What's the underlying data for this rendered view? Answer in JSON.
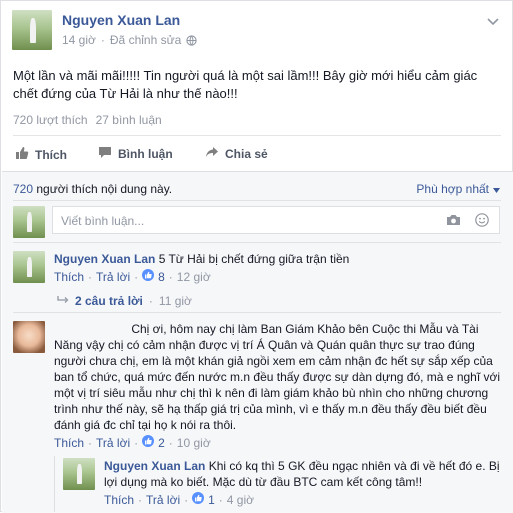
{
  "post": {
    "author": "Nguyen Xuan Lan",
    "time": "14 giờ",
    "separator": "·",
    "edited": "Đã chỉnh sửa",
    "body": "Một lần và mãi mãi!!!!! Tin người quá là một sai lầm!!! Bây giờ mới hiểu cảm giác chết đứng của Từ Hải là như thế nào!!!",
    "likes": "720 lượt thích",
    "comments": "27 bình luận"
  },
  "actions": {
    "like": "Thích",
    "comment": "Bình luận",
    "share": "Chia sẻ"
  },
  "likes_bar": {
    "count": "720",
    "text": "người thích nội dung này.",
    "sort": "Phù hợp nhất"
  },
  "composer": {
    "placeholder": "Viết bình luận..."
  },
  "comments": [
    {
      "author": "Nguyen Xuan Lan",
      "text": "5 Từ Hải bị chết đứng giữa trận tiền",
      "like": "Thích",
      "reply": "Trả lời",
      "reactions": "8",
      "time": "12 giờ",
      "replies_link": "2 câu trả lời",
      "replies_time": "11 giờ"
    },
    {
      "author": "",
      "text": "Chị ơi, hôm nay chị làm Ban Giám Khảo bên Cuộc thi Mẫu và Tài Năng vậy chị có cảm nhận được vị trí Á Quân và Quán quân thực sự trao đúng người chưa chị, em là một khán giả ngồi xem em cảm nhận đc hết sự sắp xếp của ban tổ chức, quá mức đến nước m.n đều thấy được sự dàn dựng đó, mà e nghĩ với một vị trí siêu mẫu như chị thì k nên đi làm giám khảo bù nhìn cho những chương trình như thế này, sẽ hạ thấp giá trị của mình, vì e thấy m.n đều thấy đều biết đều đánh giá đc chỉ tại họ k nói ra thôi.",
      "like": "Thích",
      "reply": "Trả lời",
      "reactions": "2",
      "time": "10 giờ"
    },
    {
      "author": "Nguyen Xuan Lan",
      "text": "Khi có kq thì 5 GK đều ngạc nhiên và đi về hết đó e. Bị lợi dụng mà ko biết. Mặc dù từ đầu BTC cam kết công tâm!!",
      "like": "Thích",
      "reply": "Trả lời",
      "reactions": "1",
      "time": "4 giờ"
    }
  ],
  "colors": {
    "link": "#3b5998",
    "meta": "#9197a3",
    "text": "#141823",
    "panel": "#f6f7f9"
  }
}
